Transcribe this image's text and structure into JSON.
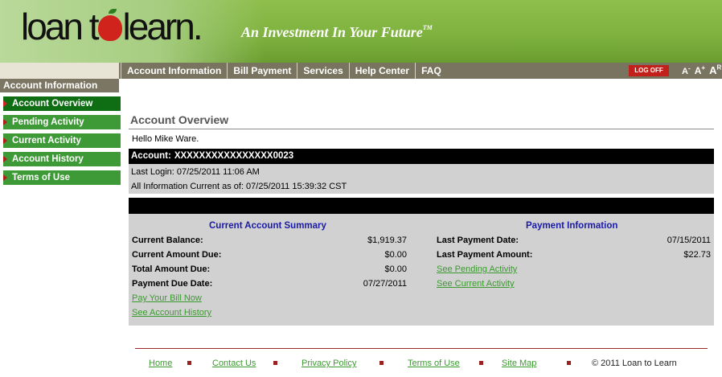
{
  "header": {
    "logo_text_1": "loan t",
    "logo_text_2": "learn.",
    "tagline": "An Investment In Your Future",
    "tagline_mark": "TM"
  },
  "nav": {
    "items": [
      "Account Information",
      "Bill Payment",
      "Services",
      "Help Center",
      "FAQ"
    ],
    "logoff_label": "LOG OFF",
    "font_sizer": [
      "A-",
      "A+",
      "AR"
    ]
  },
  "sidebar": {
    "header": "Account Information",
    "items": [
      {
        "label": "Account Overview",
        "active": true
      },
      {
        "label": "Pending Activity",
        "active": false
      },
      {
        "label": "Current Activity",
        "active": false
      },
      {
        "label": "Account History",
        "active": false
      },
      {
        "label": "Terms of Use",
        "active": false
      }
    ]
  },
  "content": {
    "title": "Account Overview",
    "greeting": "Hello Mike Ware.",
    "account_label": "Account:",
    "account_number": "XXXXXXXXXXXXXXXX0023",
    "last_login": "Last Login: 07/25/2011 11:06 AM",
    "info_current": "All Information Current as of: 07/25/2011 15:39:32 CST"
  },
  "summary": {
    "title": "Current Account Summary",
    "rows": [
      {
        "label": "Current Balance:",
        "value": "$1,919.37"
      },
      {
        "label": "Current Amount Due:",
        "value": "$0.00"
      },
      {
        "label": "Total Amount Due:",
        "value": "$0.00"
      },
      {
        "label": "Payment Due Date:",
        "value": "07/27/2011"
      }
    ],
    "links": [
      "Pay Your Bill Now",
      "See Account History"
    ]
  },
  "payment": {
    "title": "Payment Information",
    "rows": [
      {
        "label": "Last Payment Date:",
        "value": "07/15/2011"
      },
      {
        "label": "Last Payment Amount:",
        "value": "$22.73"
      }
    ],
    "links": [
      "See Pending Activity",
      "See Current Activity"
    ]
  },
  "footer": {
    "links": [
      "Home",
      "Contact Us",
      "Privacy Policy",
      "Terms of Use",
      "Site Map"
    ],
    "copyright": "© 2011 Loan to Learn"
  },
  "colors": {
    "header_green": "#7fb23f",
    "nav_bar": "#78745f",
    "sidebar_green": "#3d9a36",
    "sidebar_active": "#0f6d14",
    "logoff_red": "#c2201b",
    "section_title_blue": "#1a1aa8",
    "link_green": "#3b9a2f",
    "panel_gray": "#d1d1d1"
  },
  "icons": [
    "apple-logo-icon",
    "red-arrow-icon",
    "footer-bullet-icon"
  ]
}
